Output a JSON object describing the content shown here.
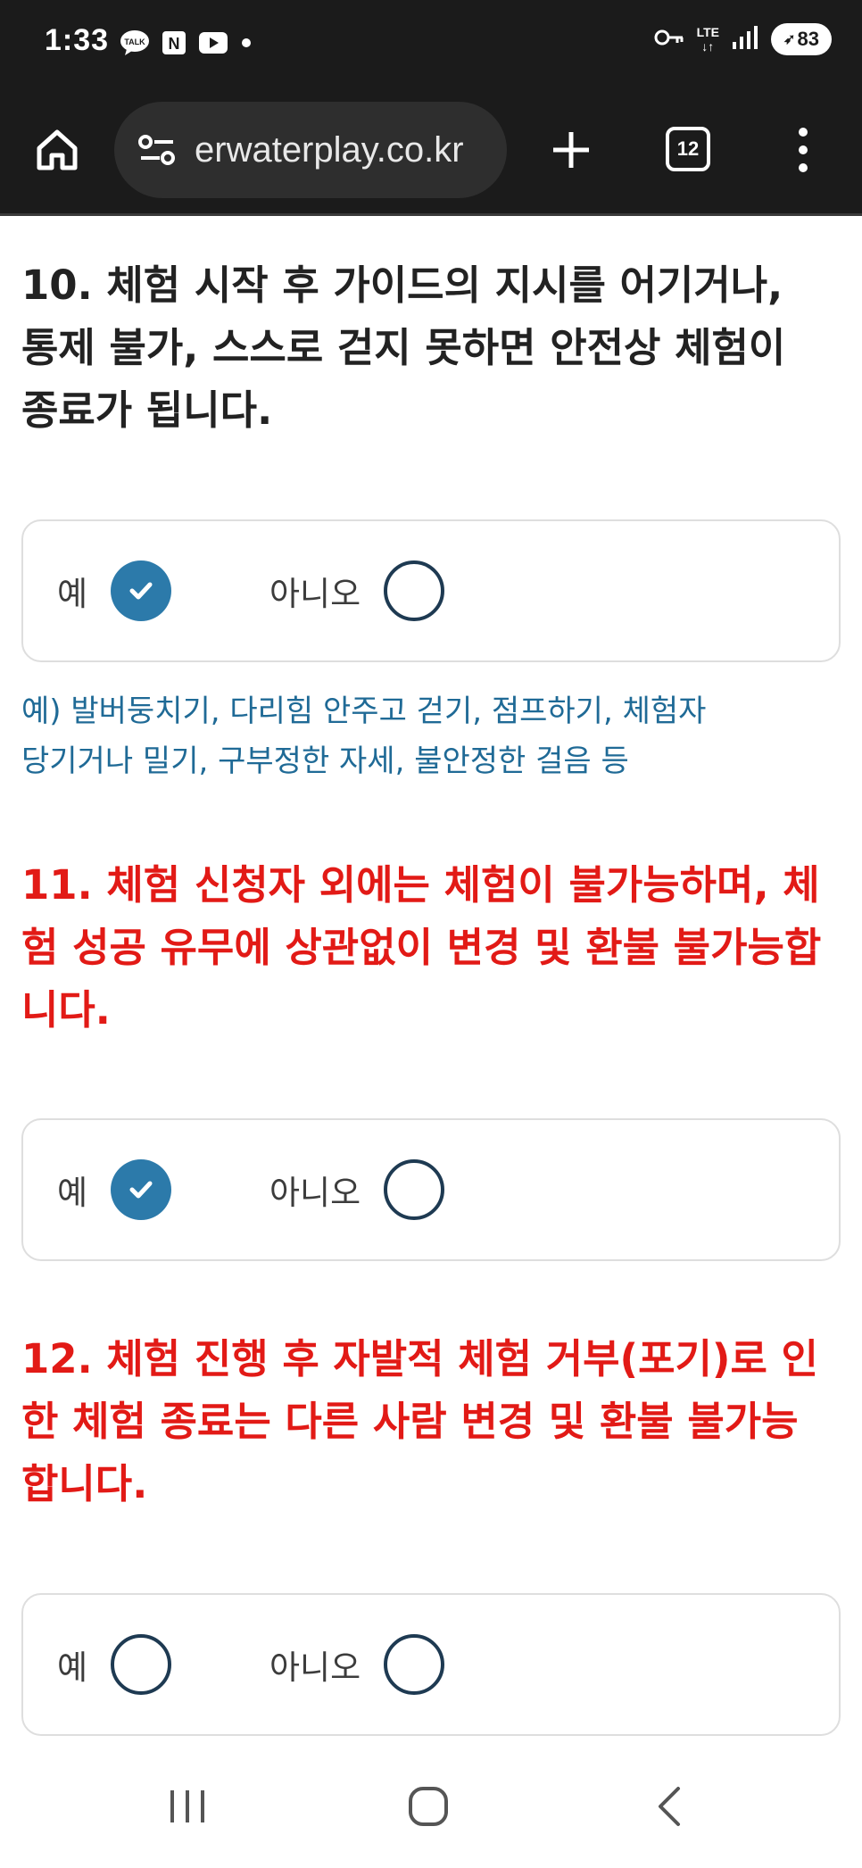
{
  "status_bar": {
    "time": "1:33",
    "notif_talk": "TALK",
    "notif_n": "N",
    "lte_label": "LTE",
    "battery": "83"
  },
  "browser": {
    "url": "erwaterplay.co.kr",
    "tab_count": "12"
  },
  "questions": [
    {
      "text": "10. 체험 시작 후 가이드의 지시를 어기거나, 통제 불가, 스스로 걷지 못하면 안전상 체험이 종료가 됩니다.",
      "color": "#222222",
      "yes_label": "예",
      "no_label": "아니오",
      "yes_checked": true,
      "no_checked": false,
      "note_line1": "예) 발버둥치기, 다리힘 안주고 걷기, 점프하기, 체험자",
      "note_line2": "당기거나 밀기, 구부정한 자세, 불안정한 걸음 등"
    },
    {
      "text": "11. 체험 신청자 외에는 체험이 불가능하며, 체험 성공 유무에 상관없이 변경 및 환불 불가능합니다.",
      "color": "#e21a16",
      "yes_label": "예",
      "no_label": "아니오",
      "yes_checked": true,
      "no_checked": false
    },
    {
      "text": "12. 체험 진행 후 자발적 체험 거부(포기)로 인한 체험 종료는 다른 사람 변경 및 환불 불가능합니다.",
      "color": "#e21a16",
      "yes_label": "예",
      "no_label": "아니오",
      "yes_checked": false,
      "no_checked": false
    }
  ],
  "colors": {
    "checked_radio": "#2c7aaa",
    "empty_radio_border": "#1e3a52",
    "note_text": "#1f6a96",
    "toolbar_bg": "#1b1b1b"
  },
  "icons": [
    "home-icon",
    "site-info-icon",
    "new-tab-icon",
    "tab-switcher-icon",
    "more-vert-icon",
    "recents-icon",
    "home-nav-icon",
    "back-icon"
  ]
}
